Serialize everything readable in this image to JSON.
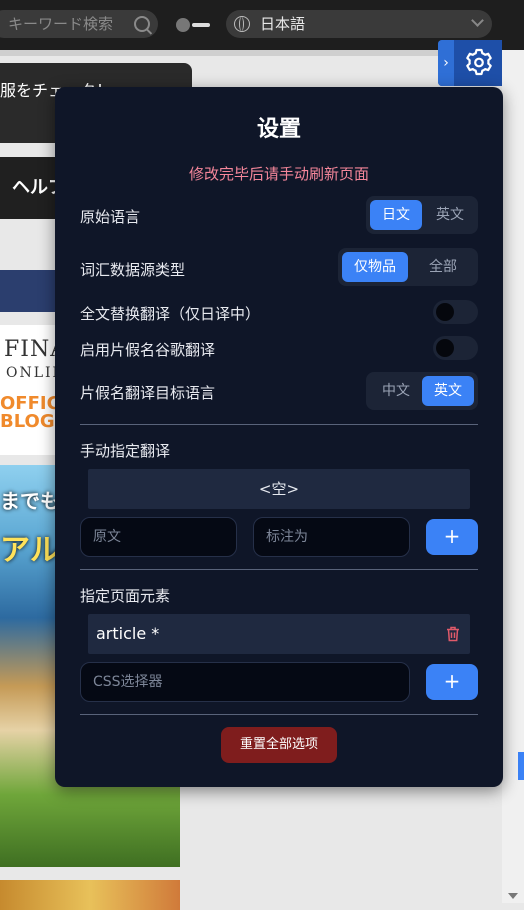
{
  "background_site": {
    "search_placeholder": "キーワード検索",
    "language": "日本語",
    "banner_text": "服をチェック！",
    "help_text": "ヘルプ",
    "logo_line1": "FINAL",
    "logo_line2": "ONLIN",
    "logo_line3": "OFFICI",
    "logo_line4": "BLOG",
    "art_text1": "までも",
    "art_text2": "アル酉"
  },
  "panel": {
    "title": "设置",
    "warning": "修改完毕后请手动刷新页面",
    "source_language": {
      "label": "原始语言",
      "options": [
        "日文",
        "英文"
      ],
      "selected": "日文"
    },
    "vocab_source": {
      "label": "词汇数据源类型",
      "options": [
        "仅物品",
        "全部"
      ],
      "selected": "仅物品"
    },
    "full_text_translate": {
      "label": "全文替换翻译（仅日译中）",
      "enabled": false
    },
    "katakana_google": {
      "label": "启用片假名谷歌翻译",
      "enabled": false
    },
    "katakana_target": {
      "label": "片假名翻译目标语言",
      "options": [
        "中文",
        "英文"
      ],
      "selected": "英文"
    },
    "manual_translation": {
      "label": "手动指定翻译",
      "empty_text": "<空>",
      "original_placeholder": "原文",
      "mark_as_placeholder": "标注为",
      "add_label": "+"
    },
    "page_elements": {
      "label": "指定页面元素",
      "items": [
        "article *"
      ],
      "css_placeholder": "CSS选择器",
      "add_label": "+"
    },
    "reset_label": "重置全部选项"
  },
  "colors": {
    "panel_bg": "#0f1628",
    "accent": "#3b82f6",
    "warning": "#f4869a",
    "danger": "#7f1d1d"
  },
  "icons": {
    "gear_tab": "gear-icon",
    "collapse": "chevron-right-icon",
    "delete": "trash-icon"
  }
}
